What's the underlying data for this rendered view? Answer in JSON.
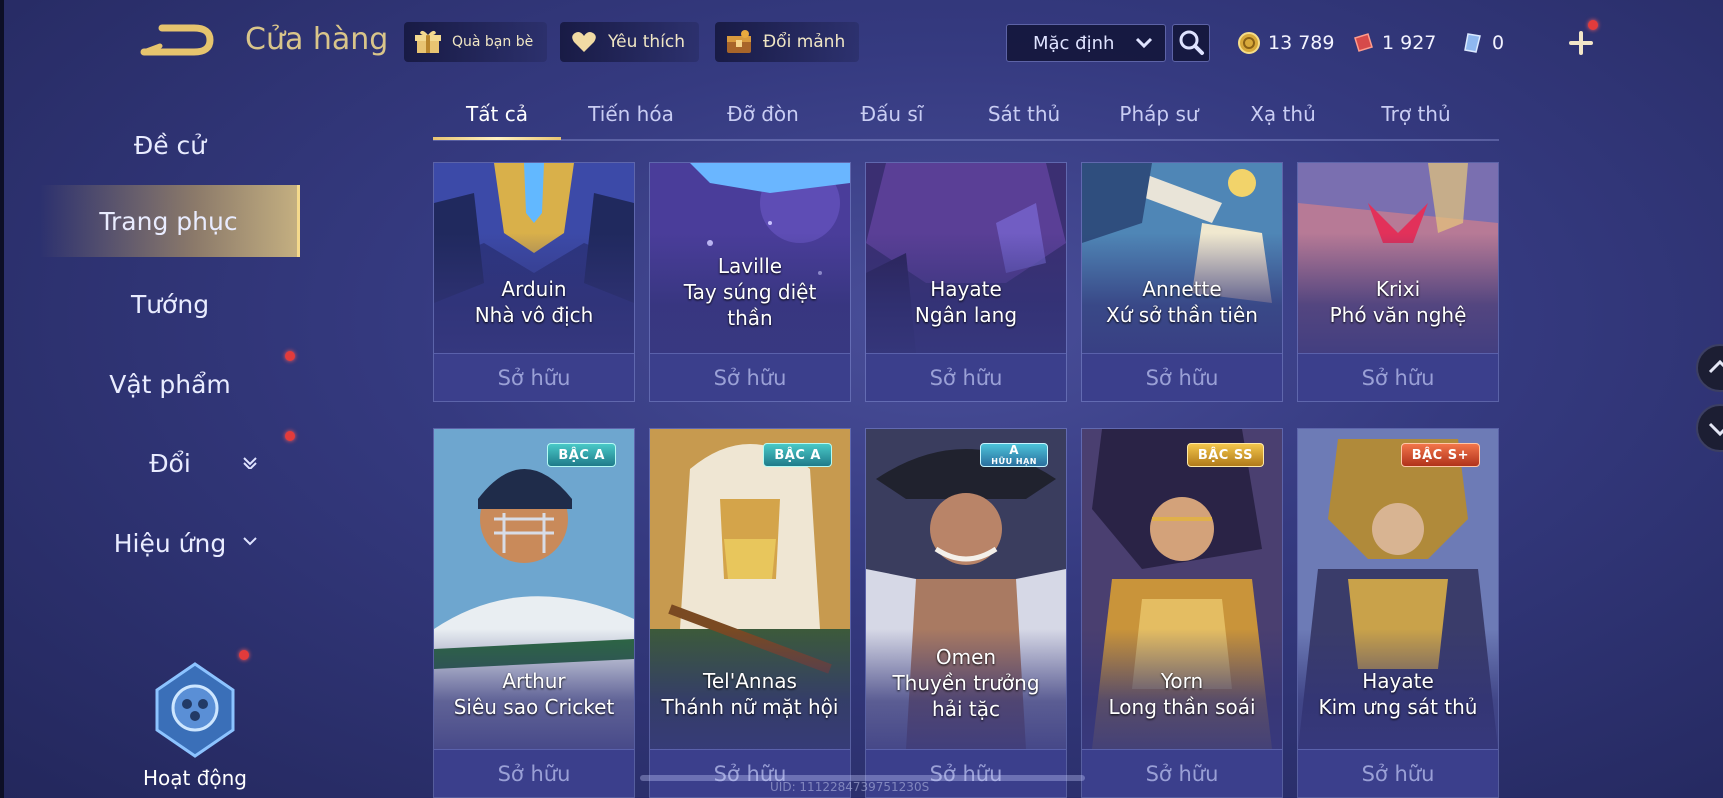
{
  "header": {
    "title": "Cửa hàng",
    "gift_label": "Quà bạn bè",
    "favorite_label": "Yêu thích",
    "exchange_label": "Đổi mảnh",
    "sort_value": "Mặc định",
    "gold": "13 789",
    "vouchers": "1 927",
    "diamonds": "0"
  },
  "sidebar": {
    "items": [
      {
        "label": "Đề cử"
      },
      {
        "label": "Trang phục"
      },
      {
        "label": "Tướng"
      },
      {
        "label": "Vật phẩm"
      },
      {
        "label": "Đổi"
      },
      {
        "label": "Hiệu ứng"
      }
    ],
    "activity_label": "Hoạt động"
  },
  "tabs": [
    "Tất cả",
    "Tiến hóa",
    "Đỡ đòn",
    "Đấu sĩ",
    "Sát thủ",
    "Pháp sư",
    "Xạ thủ",
    "Trợ thủ"
  ],
  "cards_row1": [
    {
      "hero": "Arduin",
      "skin": "Nhà vô địch",
      "status": "Sở hữu"
    },
    {
      "hero": "Laville",
      "skin": "Tay súng diệt thần",
      "status": "Sở hữu"
    },
    {
      "hero": "Hayate",
      "skin": "Ngân lang",
      "status": "Sở hữu"
    },
    {
      "hero": "Annette",
      "skin": "Xứ sở thần tiên",
      "status": "Sở hữu"
    },
    {
      "hero": "Krixi",
      "skin": "Phó văn nghệ",
      "status": "Sở hữu"
    }
  ],
  "cards_row2": [
    {
      "hero": "Arthur",
      "skin": "Siêu sao Cricket",
      "status": "Sở hữu",
      "badge": "BẬC A"
    },
    {
      "hero": "Tel'Annas",
      "skin": "Thánh nữ mặt hội",
      "status": "Sở hữu",
      "badge": "BẬC A"
    },
    {
      "hero": "Omen",
      "skin": "Thuyền trưởng hải tặc",
      "status": "Sở hữu",
      "badge": "A",
      "badge_sub": "HỮU HẠN"
    },
    {
      "hero": "Yorn",
      "skin": "Long thần soái",
      "status": "Sở hữu",
      "badge": "BẬC SS"
    },
    {
      "hero": "Hayate",
      "skin": "Kim ưng sát thủ",
      "status": "Sở hữu",
      "badge": "BẬC S+"
    }
  ],
  "footer": {
    "uid": "UID: 1112284739751230S"
  },
  "colors": {
    "accent_gold": "#e8c472",
    "notification": "#e23b3b",
    "bg": "#353a80"
  }
}
